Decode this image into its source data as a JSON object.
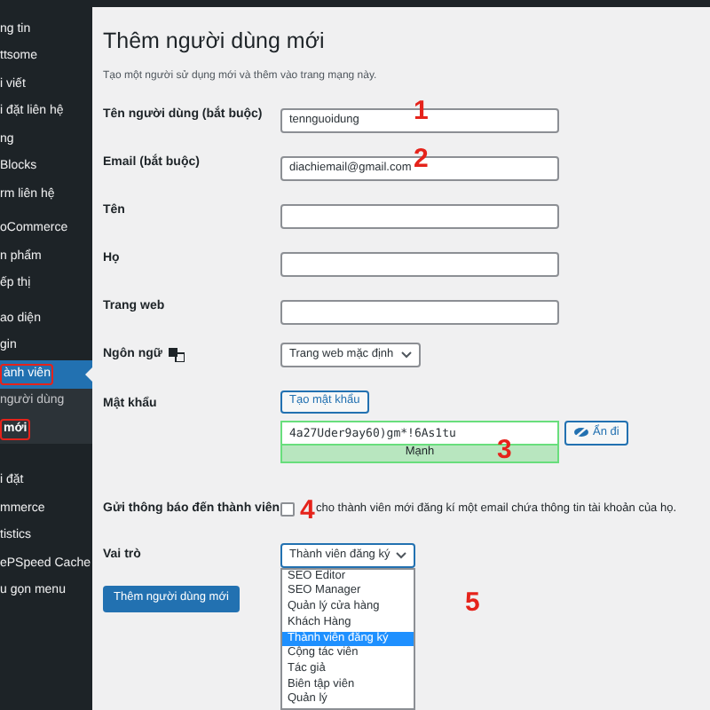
{
  "sidebar": {
    "items": [
      {
        "label": "ng tin",
        "selected": false,
        "sub": false,
        "marked": false
      },
      {
        "label": "ttsome",
        "selected": false,
        "sub": false,
        "marked": false
      },
      {
        "label": "i viết",
        "selected": false,
        "sub": false,
        "marked": false
      },
      {
        "label": "i đặt liên hệ",
        "selected": false,
        "sub": false,
        "marked": false
      },
      {
        "label": "ng",
        "selected": false,
        "sub": false,
        "marked": false
      },
      {
        "label": "Blocks",
        "selected": false,
        "sub": false,
        "marked": false
      },
      {
        "label": "rm liên hệ",
        "selected": false,
        "sub": false,
        "marked": false
      },
      {
        "label": "oCommerce",
        "selected": false,
        "sub": false,
        "marked": false
      },
      {
        "label": "n phẩm",
        "selected": false,
        "sub": false,
        "marked": false
      },
      {
        "label": "ếp thị",
        "selected": false,
        "sub": false,
        "marked": false
      },
      {
        "label": "ao diện",
        "selected": false,
        "sub": false,
        "marked": false
      },
      {
        "label": "gin",
        "selected": false,
        "sub": false,
        "marked": false
      },
      {
        "label": "ành viên",
        "selected": true,
        "sub": false,
        "marked": true
      },
      {
        "label": "người dùng",
        "selected": false,
        "sub": true,
        "marked": false
      },
      {
        "label": "mới",
        "selected": true,
        "sub": true,
        "marked": true
      },
      {
        "label": "i đặt",
        "selected": false,
        "sub": false,
        "marked": false
      },
      {
        "label": "mmerce",
        "selected": false,
        "sub": false,
        "marked": false
      },
      {
        "label": "tistics",
        "selected": false,
        "sub": false,
        "marked": false
      },
      {
        "label": "ePSpeed Cache",
        "selected": false,
        "sub": false,
        "marked": false
      },
      {
        "label": "u gọn menu",
        "selected": false,
        "sub": false,
        "marked": false
      }
    ]
  },
  "page": {
    "title": "Thêm người dùng mới",
    "description": "Tạo một người sử dụng mới và thêm vào trang mạng này."
  },
  "fields": [
    {
      "kind": "text",
      "label": "Tên người dùng (bắt buộc)",
      "value": "tennguoidung",
      "annotation": "1"
    },
    {
      "kind": "text",
      "label": "Email (bắt buộc)",
      "value": "diachiemail@gmail.com",
      "annotation": "2"
    },
    {
      "kind": "text",
      "label": "Tên"
    },
    {
      "kind": "text",
      "label": "Họ"
    },
    {
      "kind": "text",
      "label": "Trang web"
    },
    {
      "kind": "select",
      "label": "Ngôn ngữ",
      "value": "Trang web mặc định"
    },
    {
      "kind": "password",
      "label": "Mật khẩu",
      "generate": "Tạo mật khẩu",
      "value": "4a27Uder9ay60)gm*!6As1tu",
      "strength": "Mạnh",
      "toggle": "Ẩn đi",
      "annotation": "3"
    },
    {
      "kind": "checkbox",
      "label": "Gửi thông báo đến thành viên",
      "checked": false,
      "text": "cho thành viên mới đăng kí một email chứa thông tin tài khoản của họ.",
      "annotation": "4"
    },
    {
      "kind": "role",
      "label": "Vai trò",
      "value": "Thành viên đăng ký",
      "annotation": "5",
      "options": [
        {
          "label": "SEO Editor",
          "selected": false
        },
        {
          "label": "SEO Manager",
          "selected": false
        },
        {
          "label": "Quản lý cửa hàng",
          "selected": false
        },
        {
          "label": "Khách Hàng",
          "selected": false
        },
        {
          "label": "Thành viên đăng ký",
          "selected": true
        },
        {
          "label": "Cộng tác viên",
          "selected": false
        },
        {
          "label": "Tác giả",
          "selected": false
        },
        {
          "label": "Biên tập viên",
          "selected": false
        },
        {
          "label": "Quản lý",
          "selected": false
        }
      ]
    }
  ],
  "submit": "Thêm người dùng mới"
}
